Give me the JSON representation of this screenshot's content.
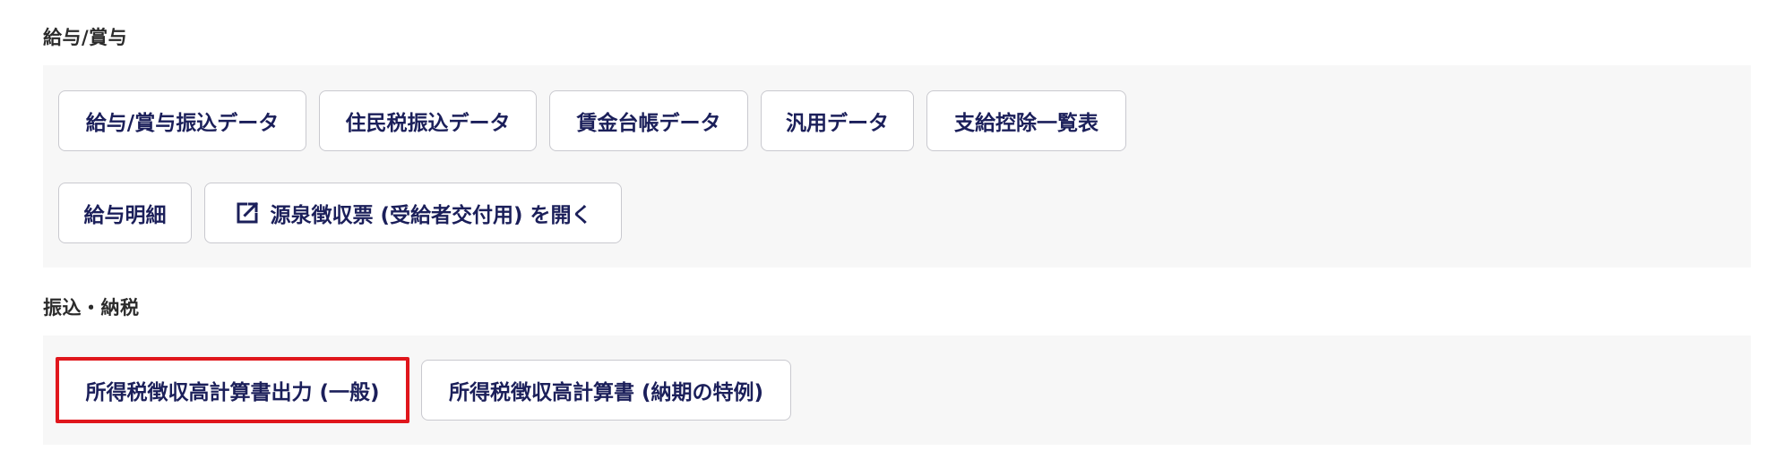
{
  "sections": [
    {
      "heading": "給与/賞与",
      "buttons": [
        {
          "label": "給与/賞与振込データ"
        },
        {
          "label": "住民税振込データ"
        },
        {
          "label": "賃金台帳データ"
        },
        {
          "label": "汎用データ"
        },
        {
          "label": "支給控除一覧表"
        },
        {
          "label": "給与明細"
        },
        {
          "label": "源泉徴収票 (受給者交付用) を開く",
          "icon": "external-link-icon"
        }
      ]
    },
    {
      "heading": "振込・納税",
      "buttons": [
        {
          "label": "所得税徴収高計算書出力 (一般)",
          "highlighted": true
        },
        {
          "label": "所得税徴収高計算書 (納期の特例)"
        }
      ]
    }
  ],
  "colors": {
    "button_text": "#1b1f5a",
    "panel_bg": "#f7f7f7",
    "highlight_border": "#e0161c"
  }
}
